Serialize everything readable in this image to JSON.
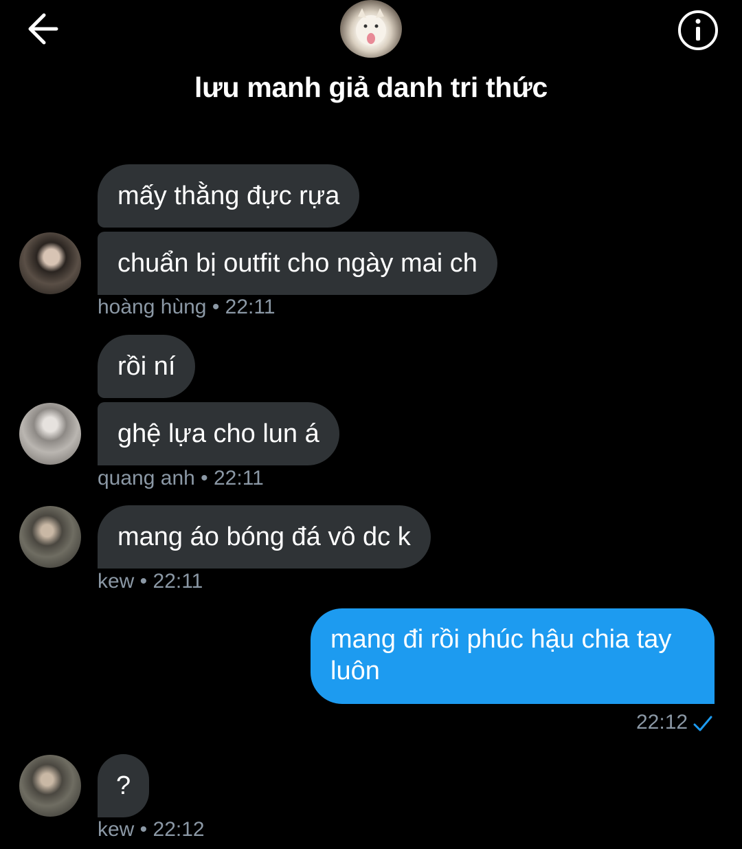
{
  "header": {
    "title": "lưu manh giả danh tri thức"
  },
  "messages": [
    {
      "text": "mấy thằng đực rựa"
    },
    {
      "text": "chuẩn bị outfit cho ngày mai ch"
    },
    {
      "meta": "hoàng hùng • 22:11"
    },
    {
      "text": "rồi ní"
    },
    {
      "text": "ghệ lựa cho lun á"
    },
    {
      "meta": "quang anh • 22:11"
    },
    {
      "text": "mang áo bóng đá vô dc k"
    },
    {
      "meta": "kew • 22:11"
    },
    {
      "text": "mang đi rồi phúc hậu chia tay luôn"
    },
    {
      "meta": "22:12"
    },
    {
      "text": "?"
    },
    {
      "meta": "kew • 22:12"
    }
  ],
  "colors": {
    "background": "#000000",
    "incoming_bubble": "#2f3336",
    "outgoing_bubble": "#1d9bf0",
    "meta_text": "#8b98a5",
    "read_check": "#1d9bf0"
  },
  "icons": {
    "back": "arrow-left-icon",
    "info": "info-icon",
    "sent": "checkmark-icon"
  }
}
